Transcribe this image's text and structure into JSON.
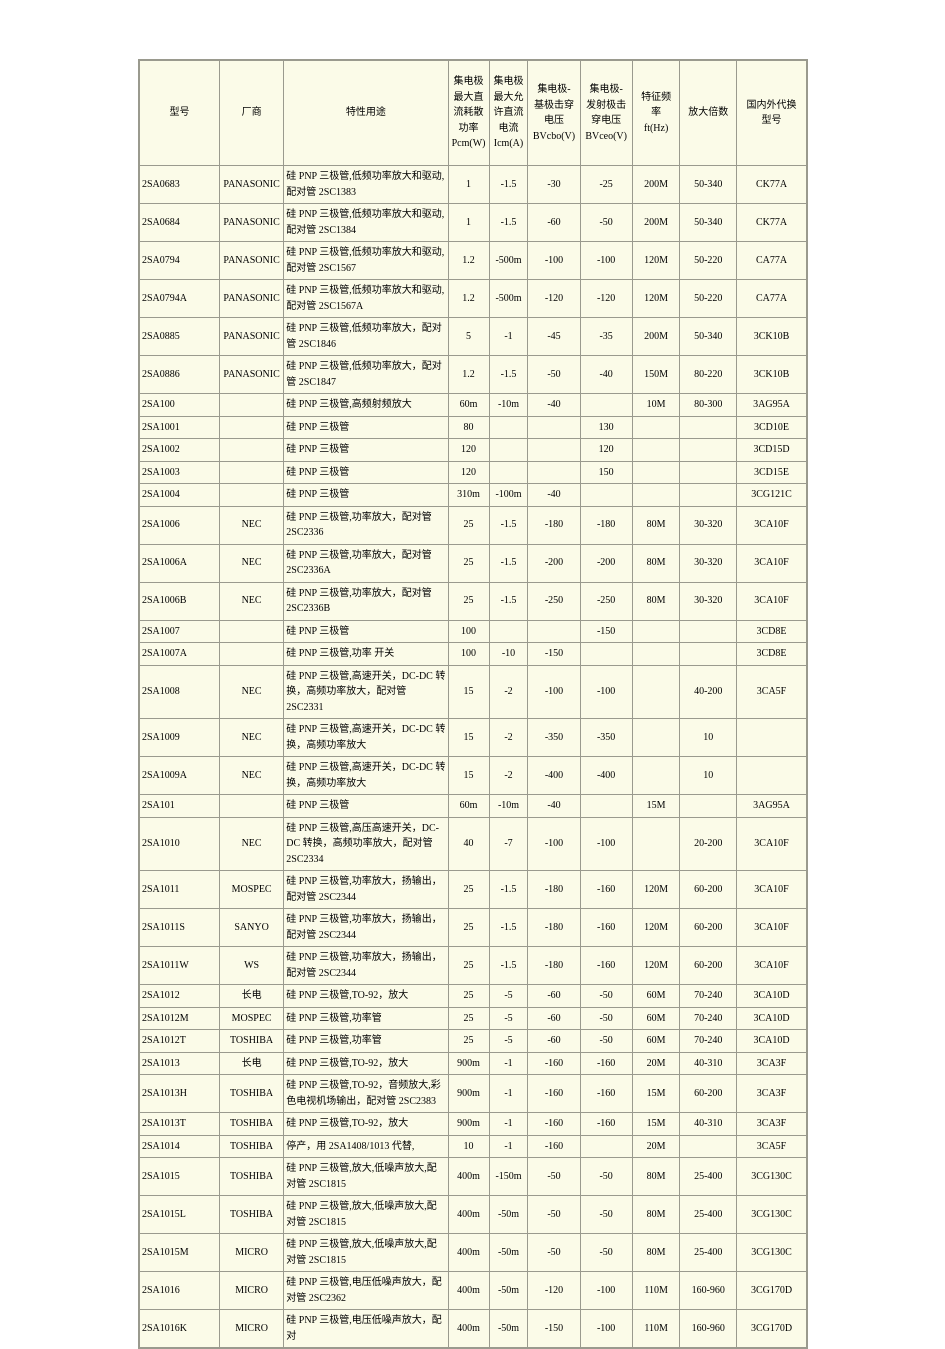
{
  "table": {
    "headers": [
      {
        "id": "model",
        "lines": [
          "型号"
        ]
      },
      {
        "id": "maker",
        "lines": [
          "厂商"
        ]
      },
      {
        "id": "desc",
        "lines": [
          "特性用途"
        ]
      },
      {
        "id": "pcm",
        "lines": [
          "集电极",
          "最大直",
          "流耗散",
          "功率",
          "Pcm(W)"
        ]
      },
      {
        "id": "icm",
        "lines": [
          "集电极",
          "最大允",
          "许直流",
          "电流",
          "Icm(A)"
        ]
      },
      {
        "id": "bvcbo",
        "lines": [
          "集电极-",
          "基极击穿",
          "电压",
          "BVcbo(V)"
        ]
      },
      {
        "id": "bvceo",
        "lines": [
          "集电极-",
          "发射极击",
          "穿电压",
          "BVceo(V)"
        ]
      },
      {
        "id": "ft",
        "lines": [
          "特征频",
          "率",
          "ft(Hz)"
        ]
      },
      {
        "id": "hfe",
        "lines": [
          "放大倍数"
        ]
      },
      {
        "id": "sub",
        "lines": [
          "国内外代换",
          "型号"
        ]
      }
    ],
    "rows": [
      {
        "model": "2SA0683",
        "maker": "PANASONIC",
        "desc": "硅 PNP 三极管,低频功率放大和驱动,配对管 2SC1383",
        "pcm": "1",
        "icm": "-1.5",
        "bvcbo": "-30",
        "bvceo": "-25",
        "ft": "200M",
        "hfe": "50-340",
        "sub": "CK77A"
      },
      {
        "model": "2SA0684",
        "maker": "PANASONIC",
        "desc": "硅 PNP 三极管,低频功率放大和驱动,配对管 2SC1384",
        "pcm": "1",
        "icm": "-1.5",
        "bvcbo": "-60",
        "bvceo": "-50",
        "ft": "200M",
        "hfe": "50-340",
        "sub": "CK77A"
      },
      {
        "model": "2SA0794",
        "maker": "PANASONIC",
        "desc": "硅 PNP 三极管,低频功率放大和驱动,配对管 2SC1567",
        "pcm": "1.2",
        "icm": "-500m",
        "bvcbo": "-100",
        "bvceo": "-100",
        "ft": "120M",
        "hfe": "50-220",
        "sub": "CA77A"
      },
      {
        "model": "2SA0794A",
        "maker": "PANASONIC",
        "desc": "硅 PNP 三极管,低频功率放大和驱动,配对管 2SC1567A",
        "pcm": "1.2",
        "icm": "-500m",
        "bvcbo": "-120",
        "bvceo": "-120",
        "ft": "120M",
        "hfe": "50-220",
        "sub": "CA77A"
      },
      {
        "model": "2SA0885",
        "maker": "PANASONIC",
        "desc": "硅 PNP 三极管,低频功率放大，配对管 2SC1846",
        "pcm": "5",
        "icm": "-1",
        "bvcbo": "-45",
        "bvceo": "-35",
        "ft": "200M",
        "hfe": "50-340",
        "sub": "3CK10B"
      },
      {
        "model": "2SA0886",
        "maker": "PANASONIC",
        "desc": "硅 PNP 三极管,低频功率放大，配对管 2SC1847",
        "pcm": "1.2",
        "icm": "-1.5",
        "bvcbo": "-50",
        "bvceo": "-40",
        "ft": "150M",
        "hfe": "80-220",
        "sub": "3CK10B"
      },
      {
        "model": "2SA100",
        "maker": "",
        "desc": "硅 PNP 三极管,高频射频放大",
        "pcm": "60m",
        "icm": "-10m",
        "bvcbo": "-40",
        "bvceo": "",
        "ft": "10M",
        "hfe": "80-300",
        "sub": "3AG95A"
      },
      {
        "model": "2SA1001",
        "maker": "",
        "desc": "硅 PNP 三极管",
        "pcm": "80",
        "icm": "",
        "bvcbo": "",
        "bvceo": "130",
        "ft": "",
        "hfe": "",
        "sub": "3CD10E"
      },
      {
        "model": "2SA1002",
        "maker": "",
        "desc": "硅 PNP 三极管",
        "pcm": "120",
        "icm": "",
        "bvcbo": "",
        "bvceo": "120",
        "ft": "",
        "hfe": "",
        "sub": "3CD15D"
      },
      {
        "model": "2SA1003",
        "maker": "",
        "desc": "硅 PNP 三极管",
        "pcm": "120",
        "icm": "",
        "bvcbo": "",
        "bvceo": "150",
        "ft": "",
        "hfe": "",
        "sub": "3CD15E"
      },
      {
        "model": "2SA1004",
        "maker": "",
        "desc": "硅 PNP 三极管",
        "pcm": "310m",
        "icm": "-100m",
        "bvcbo": "-40",
        "bvceo": "",
        "ft": "",
        "hfe": "",
        "sub": "3CG121C"
      },
      {
        "model": "2SA1006",
        "maker": "NEC",
        "desc": "硅 PNP 三极管,功率放大，配对管 2SC2336",
        "pcm": "25",
        "icm": "-1.5",
        "bvcbo": "-180",
        "bvceo": "-180",
        "ft": "80M",
        "hfe": "30-320",
        "sub": "3CA10F"
      },
      {
        "model": "2SA1006A",
        "maker": "NEC",
        "desc": "硅 PNP 三极管,功率放大，配对管 2SC2336A",
        "pcm": "25",
        "icm": "-1.5",
        "bvcbo": "-200",
        "bvceo": "-200",
        "ft": "80M",
        "hfe": "30-320",
        "sub": "3CA10F"
      },
      {
        "model": "2SA1006B",
        "maker": "NEC",
        "desc": "硅 PNP 三极管,功率放大，配对管 2SC2336B",
        "pcm": "25",
        "icm": "-1.5",
        "bvcbo": "-250",
        "bvceo": "-250",
        "ft": "80M",
        "hfe": "30-320",
        "sub": "3CA10F"
      },
      {
        "model": "2SA1007",
        "maker": "",
        "desc": "硅 PNP 三极管",
        "pcm": "100",
        "icm": "",
        "bvcbo": "",
        "bvceo": "-150",
        "ft": "",
        "hfe": "",
        "sub": "3CD8E"
      },
      {
        "model": "2SA1007A",
        "maker": "",
        "desc": "硅 PNP 三极管,功率 开关",
        "pcm": "100",
        "icm": "-10",
        "bvcbo": "-150",
        "bvceo": "",
        "ft": "",
        "hfe": "",
        "sub": "3CD8E"
      },
      {
        "model": "2SA1008",
        "maker": "NEC",
        "desc": "硅 PNP 三极管,高速开关，DC-DC 转换，高频功率放大，配对管 2SC2331",
        "pcm": "15",
        "icm": "-2",
        "bvcbo": "-100",
        "bvceo": "-100",
        "ft": "",
        "hfe": "40-200",
        "sub": "3CA5F"
      },
      {
        "model": "2SA1009",
        "maker": "NEC",
        "desc": "硅 PNP 三极管,高速开关，DC-DC 转换，高频功率放大",
        "pcm": "15",
        "icm": "-2",
        "bvcbo": "-350",
        "bvceo": "-350",
        "ft": "",
        "hfe": "10",
        "sub": ""
      },
      {
        "model": "2SA1009A",
        "maker": "NEC",
        "desc": "硅 PNP 三极管,高速开关，DC-DC 转换，高频功率放大",
        "pcm": "15",
        "icm": "-2",
        "bvcbo": "-400",
        "bvceo": "-400",
        "ft": "",
        "hfe": "10",
        "sub": ""
      },
      {
        "model": "2SA101",
        "maker": "",
        "desc": "硅 PNP 三极管",
        "pcm": "60m",
        "icm": "-10m",
        "bvcbo": "-40",
        "bvceo": "",
        "ft": "15M",
        "hfe": "",
        "sub": "3AG95A"
      },
      {
        "model": "2SA1010",
        "maker": "NEC",
        "desc": "硅 PNP 三极管,高压高速开关，DC-DC 转换，高频功率放大，配对管 2SC2334",
        "pcm": "40",
        "icm": "-7",
        "bvcbo": "-100",
        "bvceo": "-100",
        "ft": "",
        "hfe": "20-200",
        "sub": "3CA10F"
      },
      {
        "model": "2SA1011",
        "maker": "MOSPEC",
        "desc": "硅 PNP 三极管,功率放大，扬输出，配对管 2SC2344",
        "pcm": "25",
        "icm": "-1.5",
        "bvcbo": "-180",
        "bvceo": "-160",
        "ft": "120M",
        "hfe": "60-200",
        "sub": "3CA10F"
      },
      {
        "model": "2SA1011S",
        "maker": "SANYO",
        "desc": "硅 PNP 三极管,功率放大，扬输出，配对管 2SC2344",
        "pcm": "25",
        "icm": "-1.5",
        "bvcbo": "-180",
        "bvceo": "-160",
        "ft": "120M",
        "hfe": "60-200",
        "sub": "3CA10F"
      },
      {
        "model": "2SA1011W",
        "maker": "WS",
        "desc": "硅 PNP 三极管,功率放大，扬输出，配对管 2SC2344",
        "pcm": "25",
        "icm": "-1.5",
        "bvcbo": "-180",
        "bvceo": "-160",
        "ft": "120M",
        "hfe": "60-200",
        "sub": "3CA10F"
      },
      {
        "model": "2SA1012",
        "maker": "长电",
        "desc": "硅 PNP 三极管,TO-92，放大",
        "pcm": "25",
        "icm": "-5",
        "bvcbo": "-60",
        "bvceo": "-50",
        "ft": "60M",
        "hfe": "70-240",
        "sub": "3CA10D"
      },
      {
        "model": "2SA1012M",
        "maker": "MOSPEC",
        "desc": "硅 PNP 三极管,功率管",
        "pcm": "25",
        "icm": "-5",
        "bvcbo": "-60",
        "bvceo": "-50",
        "ft": "60M",
        "hfe": "70-240",
        "sub": "3CA10D"
      },
      {
        "model": "2SA1012T",
        "maker": "TOSHIBA",
        "desc": "硅 PNP 三极管,功率管",
        "pcm": "25",
        "icm": "-5",
        "bvcbo": "-60",
        "bvceo": "-50",
        "ft": "60M",
        "hfe": "70-240",
        "sub": "3CA10D"
      },
      {
        "model": "2SA1013",
        "maker": "长电",
        "desc": "硅 PNP 三极管,TO-92，放大",
        "pcm": "900m",
        "icm": "-1",
        "bvcbo": "-160",
        "bvceo": "-160",
        "ft": "20M",
        "hfe": "40-310",
        "sub": "3CA3F"
      },
      {
        "model": "2SA1013H",
        "maker": "TOSHIBA",
        "desc": "硅 PNP 三极管,TO-92，音频放大,彩色电视机场输出，配对管 2SC2383",
        "pcm": "900m",
        "icm": "-1",
        "bvcbo": "-160",
        "bvceo": "-160",
        "ft": "15M",
        "hfe": "60-200",
        "sub": "3CA3F"
      },
      {
        "model": "2SA1013T",
        "maker": "TOSHIBA",
        "desc": "硅 PNP 三极管,TO-92，放大",
        "pcm": "900m",
        "icm": "-1",
        "bvcbo": "-160",
        "bvceo": "-160",
        "ft": "15M",
        "hfe": "40-310",
        "sub": "3CA3F"
      },
      {
        "model": "2SA1014",
        "maker": "TOSHIBA",
        "desc": "停产，用 2SA1408/1013 代替,",
        "pcm": "10",
        "icm": "-1",
        "bvcbo": "-160",
        "bvceo": "",
        "ft": "20M",
        "hfe": "",
        "sub": "3CA5F"
      },
      {
        "model": "2SA1015",
        "maker": "TOSHIBA",
        "desc": "硅 PNP 三极管,放大,低噪声放大,配对管 2SC1815",
        "pcm": "400m",
        "icm": "-150m",
        "bvcbo": "-50",
        "bvceo": "-50",
        "ft": "80M",
        "hfe": "25-400",
        "sub": "3CG130C"
      },
      {
        "model": "2SA1015L",
        "maker": "TOSHIBA",
        "desc": "硅 PNP 三极管,放大,低噪声放大,配对管 2SC1815",
        "pcm": "400m",
        "icm": "-50m",
        "bvcbo": "-50",
        "bvceo": "-50",
        "ft": "80M",
        "hfe": "25-400",
        "sub": "3CG130C"
      },
      {
        "model": "2SA1015M",
        "maker": "MICRO",
        "desc": "硅 PNP 三极管,放大,低噪声放大,配对管 2SC1815",
        "pcm": "400m",
        "icm": "-50m",
        "bvcbo": "-50",
        "bvceo": "-50",
        "ft": "80M",
        "hfe": "25-400",
        "sub": "3CG130C"
      },
      {
        "model": "2SA1016",
        "maker": "MICRO",
        "desc": "硅 PNP 三极管,电压低噪声放大，配对管 2SC2362",
        "pcm": "400m",
        "icm": "-50m",
        "bvcbo": "-120",
        "bvceo": "-100",
        "ft": "110M",
        "hfe": "160-960",
        "sub": "3CG170D"
      },
      {
        "model": "2SA1016K",
        "maker": "MICRO",
        "desc": "硅 PNP 三极管,电压低噪声放大，配对",
        "pcm": "400m",
        "icm": "-50m",
        "bvcbo": "-150",
        "bvceo": "-100",
        "ft": "110M",
        "hfe": "160-960",
        "sub": "3CG170D"
      }
    ]
  }
}
